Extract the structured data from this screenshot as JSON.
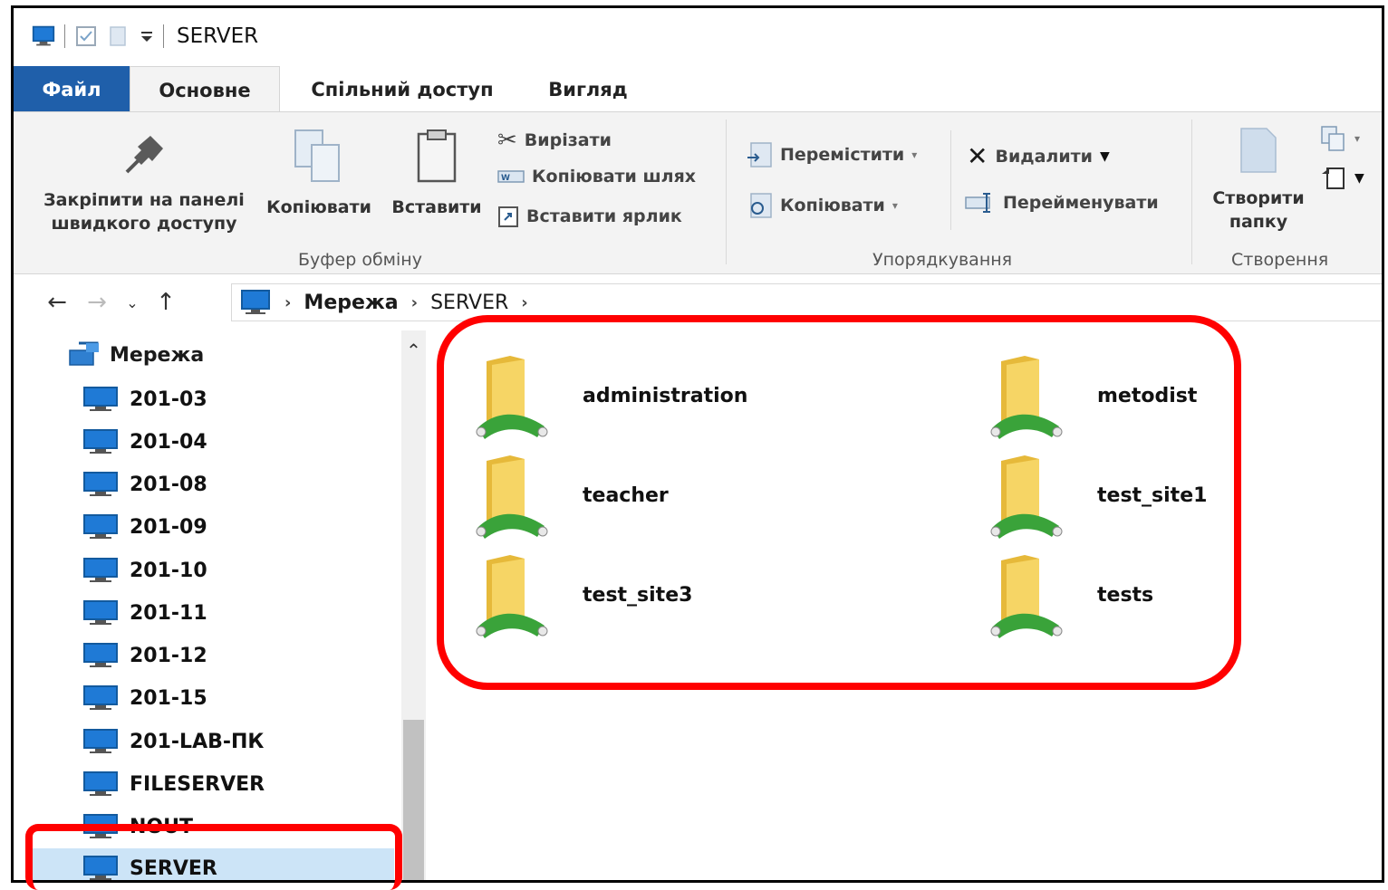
{
  "window": {
    "title": "SERVER"
  },
  "ribbon": {
    "tabs": {
      "file": "Файл",
      "home": "Основне",
      "share": "Спільний доступ",
      "view": "Вигляд"
    },
    "clipboard": {
      "pin": "Закріпити на панелі швидкого доступу",
      "copy": "Копіювати",
      "paste": "Вставити",
      "cut": "Вирізати",
      "copy_path": "Копіювати шлях",
      "paste_shortcut": "Вставити ярлик",
      "group_label": "Буфер обміну"
    },
    "organize": {
      "move_to": "Перемістити",
      "copy_to": "Копіювати",
      "delete": "Видалити",
      "rename": "Перейменувати",
      "group_label": "Упорядкування"
    },
    "new": {
      "new_folder": "Створити папку",
      "group_label": "Створення"
    }
  },
  "address": {
    "crumbs": [
      "Мережа",
      "SERVER"
    ]
  },
  "nav": {
    "root": "Мережа",
    "items": [
      "201-03",
      "201-04",
      "201-08",
      "201-09",
      "201-10",
      "201-11",
      "201-12",
      "201-15",
      "201-LAB-ПК",
      "FILESERVER",
      "NOUT",
      "SERVER"
    ],
    "selected": "SERVER"
  },
  "folders": [
    "administration",
    "metodist",
    "teacher",
    "test_site1",
    "test_site3",
    "tests"
  ],
  "colors": {
    "accent": "#1f5faa",
    "highlight": "#ff0000",
    "selection": "#cce4f7",
    "folder": "#f2c84b",
    "share": "#3aa33a"
  }
}
